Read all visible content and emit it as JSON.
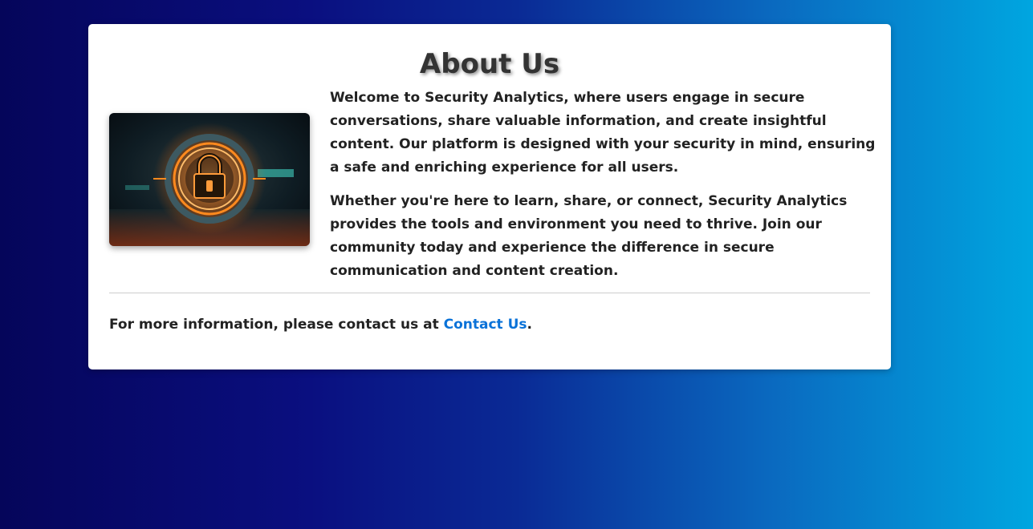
{
  "about": {
    "title": "About Us",
    "paragraphs": [
      "Welcome to Security Analytics, where users engage in secure conversations, share valuable information, and create insightful content. Our platform is designed with your security in mind, ensuring a safe and enriching experience for all users.",
      "Whether you're here to learn, share, or connect, Security Analytics provides the tools and environment you need to thrive. Join our community today and experience the difference in secure communication and content creation."
    ],
    "image_icon": "padlock-icon"
  },
  "contact": {
    "prefix": "For more information, please contact us at ",
    "link_label": "Contact Us",
    "suffix": "."
  },
  "colors": {
    "link": "#0a72d8",
    "glow": "#ff8a1e"
  }
}
